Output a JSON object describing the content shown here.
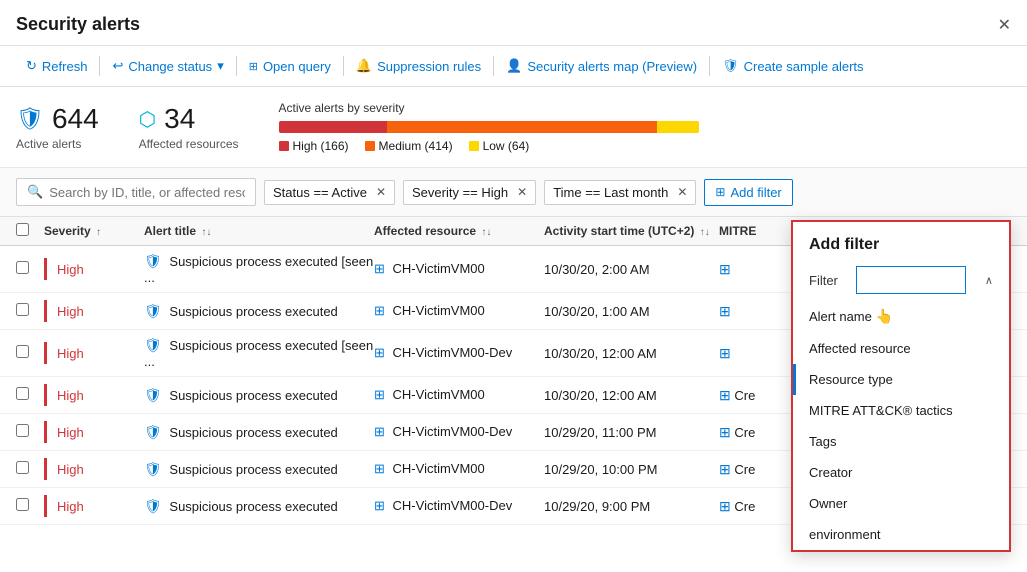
{
  "header": {
    "title": "Security alerts",
    "close_label": "✕"
  },
  "toolbar": {
    "buttons": [
      {
        "id": "refresh",
        "label": "Refresh",
        "icon": "↻"
      },
      {
        "id": "change-status",
        "label": "Change status",
        "icon": "↩",
        "has_arrow": true
      },
      {
        "id": "open-query",
        "label": "Open query",
        "icon": "⊞"
      },
      {
        "id": "suppression-rules",
        "label": "Suppression rules",
        "icon": "🔔"
      },
      {
        "id": "alerts-map",
        "label": "Security alerts map (Preview)",
        "icon": "👤"
      },
      {
        "id": "sample-alerts",
        "label": "Create sample alerts",
        "icon": "🛡"
      }
    ]
  },
  "stats": {
    "active_alerts": {
      "number": "644",
      "label": "Active alerts"
    },
    "affected_resources": {
      "number": "34",
      "label": "Affected resources"
    },
    "chart": {
      "title": "Active alerts by severity",
      "high_count": 166,
      "medium_count": 414,
      "low_count": 64,
      "legend": [
        {
          "label": "High (166)",
          "color": "#d13438"
        },
        {
          "label": "Medium (414)",
          "color": "#f7630c"
        },
        {
          "label": "Low (64)",
          "color": "#ffd700"
        }
      ]
    }
  },
  "filters": {
    "search_placeholder": "Search by ID, title, or affected resource",
    "active_filters": [
      {
        "id": "status",
        "label": "Status == Active"
      },
      {
        "id": "severity",
        "label": "Severity == High"
      },
      {
        "id": "time",
        "label": "Time == Last month"
      }
    ],
    "add_filter_label": "Add filter"
  },
  "table": {
    "columns": [
      {
        "id": "severity",
        "label": "Severity"
      },
      {
        "id": "alert",
        "label": "Alert title"
      },
      {
        "id": "resource",
        "label": "Affected resource"
      },
      {
        "id": "time",
        "label": "Activity start time (UTC+2)"
      },
      {
        "id": "mitre",
        "label": "MITRE"
      }
    ],
    "rows": [
      {
        "severity": "High",
        "alert": "Suspicious process executed [seen ...",
        "resource": "CH-VictimVM00",
        "time": "10/30/20, 2:00 AM",
        "mitre": ""
      },
      {
        "severity": "High",
        "alert": "Suspicious process executed",
        "resource": "CH-VictimVM00",
        "time": "10/30/20, 1:00 AM",
        "mitre": ""
      },
      {
        "severity": "High",
        "alert": "Suspicious process executed [seen ...",
        "resource": "CH-VictimVM00-Dev",
        "time": "10/30/20, 12:00 AM",
        "mitre": ""
      },
      {
        "severity": "High",
        "alert": "Suspicious process executed",
        "resource": "CH-VictimVM00",
        "time": "10/30/20, 12:00 AM",
        "mitre": "Cre"
      },
      {
        "severity": "High",
        "alert": "Suspicious process executed",
        "resource": "CH-VictimVM00-Dev",
        "time": "10/29/20, 11:00 PM",
        "mitre": "Cre"
      },
      {
        "severity": "High",
        "alert": "Suspicious process executed",
        "resource": "CH-VictimVM00",
        "time": "10/29/20, 10:00 PM",
        "mitre": "Cre"
      },
      {
        "severity": "High",
        "alert": "Suspicious process executed",
        "resource": "CH-VictimVM00-Dev",
        "time": "10/29/20, 9:00 PM",
        "mitre": "Cre"
      }
    ]
  },
  "add_filter_dropdown": {
    "title": "Add filter",
    "filter_label": "Filter",
    "items": [
      {
        "id": "alert-name",
        "label": "Alert name",
        "selected": false
      },
      {
        "id": "affected-resource",
        "label": "Affected resource",
        "selected": false
      },
      {
        "id": "resource-type",
        "label": "Resource type",
        "selected": true
      },
      {
        "id": "mitre-tactics",
        "label": "MITRE ATT&CK® tactics",
        "selected": false
      },
      {
        "id": "tags",
        "label": "Tags",
        "selected": false
      },
      {
        "id": "creator",
        "label": "Creator",
        "selected": false
      },
      {
        "id": "owner",
        "label": "Owner",
        "selected": false
      },
      {
        "id": "environment",
        "label": "environment",
        "selected": false
      }
    ]
  }
}
